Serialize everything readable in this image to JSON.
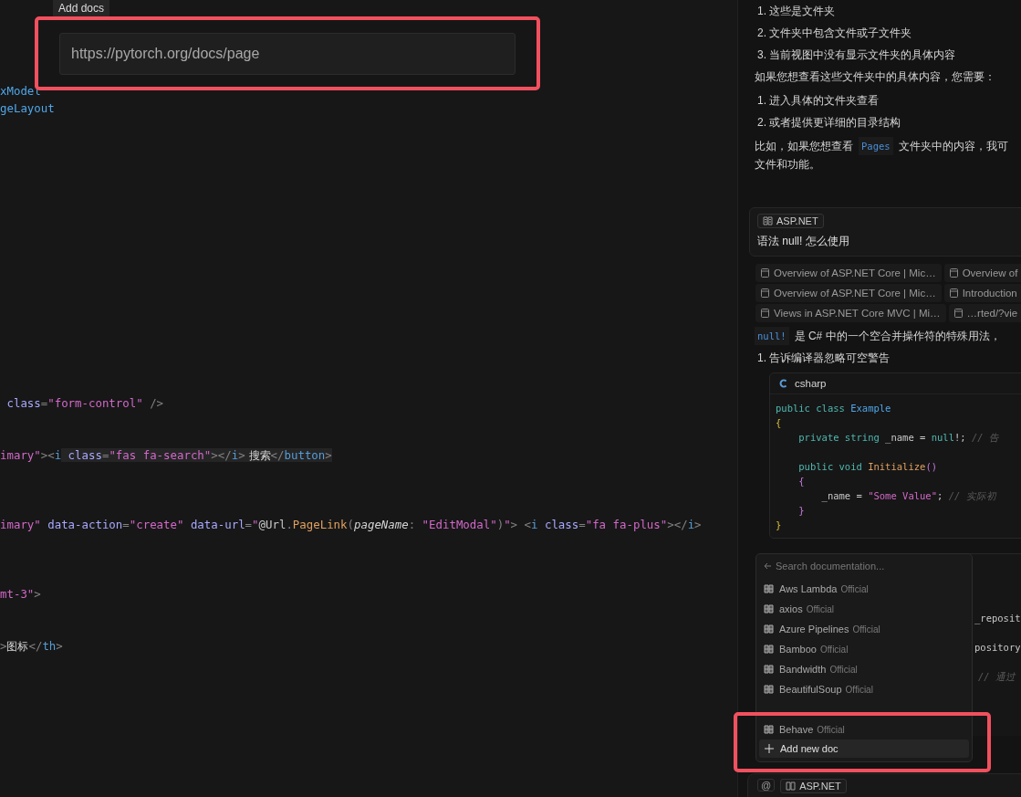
{
  "tooltip": "Add docs",
  "url_field": {
    "placeholder": "https://pytorch.org/docs/page",
    "highlighted": true
  },
  "editor": {
    "lines": [
      [
        {
          "t": "xModel",
          "kind": "type"
        }
      ],
      [
        {
          "t": "geLayout",
          "kind": "type"
        }
      ],
      [
        {
          "t": " class",
          "kind": "attr"
        },
        {
          "t": "=",
          "kind": "punct"
        },
        {
          "t": "\"form-control\"",
          "kind": "str"
        },
        {
          "t": " />",
          "kind": "punct"
        }
      ],
      [
        {
          "t": "imary\"",
          "kind": "str"
        },
        {
          "t": "><",
          "kind": "punct"
        },
        {
          "t": "i",
          "kind": "tag"
        },
        {
          "t": " class",
          "kind": "attr"
        },
        {
          "t": "=",
          "kind": "punct"
        },
        {
          "t": "\"fas fa-search\"",
          "kind": "str"
        },
        {
          "t": "></",
          "kind": "punct"
        },
        {
          "t": "i",
          "kind": "tag"
        },
        {
          "t": ">",
          "kind": "punct"
        },
        {
          "t": " 搜索",
          "kind": "text"
        },
        {
          "t": "</",
          "kind": "punct"
        },
        {
          "t": "button",
          "kind": "tag"
        },
        {
          "t": ">",
          "kind": "punct"
        }
      ],
      [
        {
          "t": "imary\"",
          "kind": "str"
        },
        {
          "t": " data-action",
          "kind": "attr"
        },
        {
          "t": "=",
          "kind": "punct"
        },
        {
          "t": "\"create\"",
          "kind": "str"
        },
        {
          "t": " data-url",
          "kind": "attr"
        },
        {
          "t": "=",
          "kind": "punct"
        },
        {
          "t": "\"",
          "kind": "str"
        },
        {
          "t": "@Url",
          "kind": "razor"
        },
        {
          "t": ".",
          "kind": "punct"
        },
        {
          "t": "PageLink",
          "kind": "method"
        },
        {
          "t": "(",
          "kind": "punct"
        },
        {
          "t": "pageName",
          "kind": "param"
        },
        {
          "t": ": ",
          "kind": "punct"
        },
        {
          "t": "\"EditModal\"",
          "kind": "str"
        },
        {
          "t": ")",
          "kind": "punct"
        },
        {
          "t": "\"",
          "kind": "str"
        },
        {
          "t": "> <",
          "kind": "punct"
        },
        {
          "t": "i",
          "kind": "tag"
        },
        {
          "t": " class",
          "kind": "attr"
        },
        {
          "t": "=",
          "kind": "punct"
        },
        {
          "t": "\"fa fa-plus\"",
          "kind": "str"
        },
        {
          "t": "></",
          "kind": "punct"
        },
        {
          "t": "i",
          "kind": "tag"
        },
        {
          "t": ">",
          "kind": "punct"
        }
      ],
      [
        {
          "t": "mt-3\"",
          "kind": "str"
        },
        {
          "t": ">",
          "kind": "punct"
        }
      ],
      [
        {
          "t": ">",
          "kind": "punct"
        },
        {
          "t": "图标",
          "kind": "text"
        },
        {
          "t": "</",
          "kind": "punct"
        },
        {
          "t": "th",
          "kind": "tag"
        },
        {
          "t": ">",
          "kind": "punct"
        }
      ]
    ]
  },
  "chat": {
    "list1": [
      "1. 这些是文件夹",
      "2. 文件夹中包含文件或子文件夹",
      "3. 当前视图中没有显示文件夹的具体内容"
    ],
    "para1": "如果您想查看这些文件夹中的具体内容，您需要：",
    "list2": [
      "1. 进入具体的文件夹查看",
      "2. 或者提供更详细的目录结构"
    ],
    "para2": {
      "before": "比如，如果您想查看",
      "code": "Pages",
      "after": "文件夹中的内容，我可",
      "line2": "文件和功能。"
    },
    "query": {
      "chip": "ASP.NET",
      "text": "语法 null! 怎么使用"
    },
    "sources": [
      [
        "Overview of ASP.NET Core | Mic…",
        "Overview of"
      ],
      [
        "Overview of ASP.NET Core | Mic…",
        "Introduction"
      ],
      [
        "Views in ASP.NET Core MVC | Mi…",
        "…rted/?vie"
      ]
    ],
    "answer": {
      "code": "null!",
      "text": "是 C# 中的一个空合并操作符的特殊用法，"
    },
    "list3": [
      "1. 告诉编译器忽略可空警告"
    ],
    "code_block": {
      "language": "csharp",
      "lines": [
        [
          {
            "t": "public class ",
            "kind": "kw"
          },
          {
            "t": "Example",
            "kind": "type"
          }
        ],
        [
          {
            "t": "{",
            "kind": "brace1"
          }
        ],
        [
          {
            "t": "    private string ",
            "kind": "kw"
          },
          {
            "t": "_name = ",
            "kind": "plain"
          },
          {
            "t": "null",
            "kind": "kw"
          },
          {
            "t": "!; ",
            "kind": "plain"
          },
          {
            "t": "// 告",
            "kind": "comment"
          }
        ],
        [
          {
            "t": "    public void ",
            "kind": "kw"
          },
          {
            "t": "Initialize",
            "kind": "method"
          },
          {
            "t": "()",
            "kind": "brace2"
          }
        ],
        [
          {
            "t": "    {",
            "kind": "brace2"
          }
        ],
        [
          {
            "t": "        _name = ",
            "kind": "plain"
          },
          {
            "t": "\"Some Value\"",
            "kind": "str"
          },
          {
            "t": "; ",
            "kind": "plain"
          },
          {
            "t": "// 实际初",
            "kind": "comment"
          }
        ],
        [
          {
            "t": "    }",
            "kind": "brace2"
          }
        ],
        [
          {
            "t": "}",
            "kind": "brace1"
          }
        ]
      ]
    },
    "code_fragments": [
      {
        "t": "_reposit",
        "kind": "plain"
      },
      {
        "t": "pository",
        "kind": "plain"
      },
      {
        "t": "// 通过",
        "kind": "comment"
      }
    ]
  },
  "docs_popup": {
    "search_placeholder": "Search documentation...",
    "items": [
      {
        "name": "Aws Lambda",
        "tag": "Official"
      },
      {
        "name": "axios",
        "tag": "Official"
      },
      {
        "name": "Azure Pipelines",
        "tag": "Official"
      },
      {
        "name": "Bamboo",
        "tag": "Official"
      },
      {
        "name": "Bandwidth",
        "tag": "Official"
      },
      {
        "name": "BeautifulSoup",
        "tag": "Official"
      },
      {
        "name": "Behave",
        "tag": "Official"
      }
    ],
    "add_label": "Add new doc",
    "highlighted": true
  },
  "input_bar": {
    "mention": "@",
    "chip": "ASP.NET"
  }
}
